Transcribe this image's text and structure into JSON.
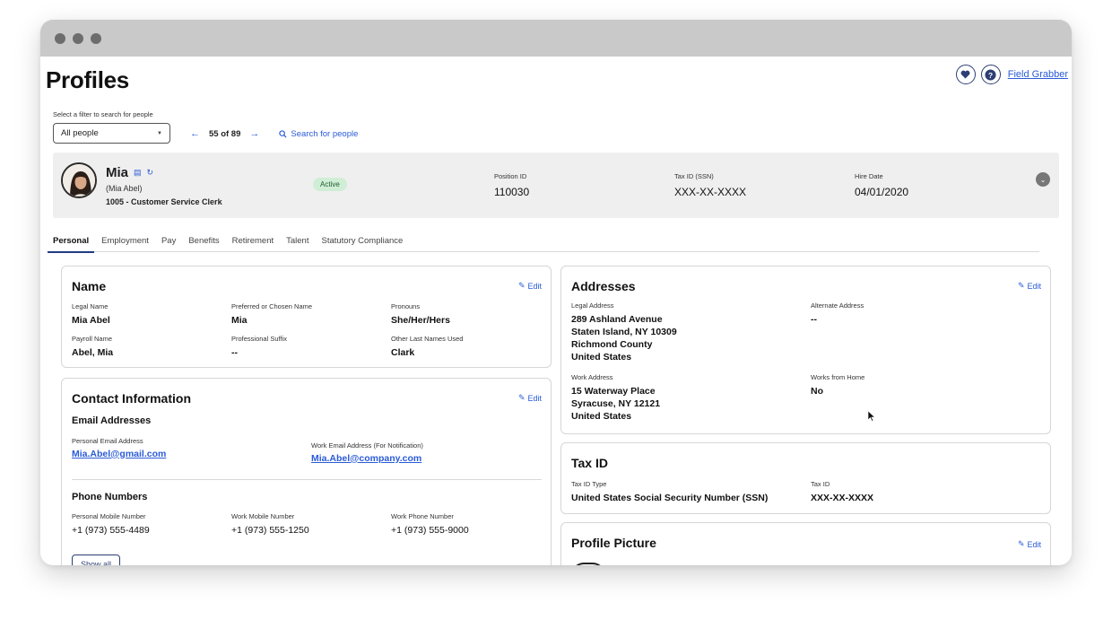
{
  "page": {
    "title": "Profiles"
  },
  "top_actions": {
    "field_grabber_label": "Field Grabber"
  },
  "filter": {
    "label": "Select a filter to search for people",
    "selected": "All people",
    "count_label": "55 of 89",
    "search_label": "Search for people"
  },
  "profile": {
    "name": "Mia",
    "alt_name": "(Mia Abel)",
    "role": "1005 - Customer Service Clerk",
    "status": "Active",
    "position_id_label": "Position ID",
    "position_id": "110030",
    "tax_id_label": "Tax ID (SSN)",
    "tax_id": "XXX-XX-XXXX",
    "hire_date_label": "Hire Date",
    "hire_date": "04/01/2020"
  },
  "tabs": [
    "Personal",
    "Employment",
    "Pay",
    "Benefits",
    "Retirement",
    "Talent",
    "Statutory Compliance"
  ],
  "edit_label": "Edit",
  "name_card": {
    "title": "Name",
    "fields": [
      {
        "label": "Legal Name",
        "value": "Mia Abel"
      },
      {
        "label": "Preferred or Chosen Name",
        "value": "Mia"
      },
      {
        "label": "Pronouns",
        "value": "She/Her/Hers"
      },
      {
        "label": "Payroll Name",
        "value": "Abel, Mia"
      },
      {
        "label": "Professional Suffix",
        "value": "--"
      },
      {
        "label": "Other Last Names Used",
        "value": "Clark"
      }
    ]
  },
  "contact_card": {
    "title": "Contact Information",
    "email_section": "Email Addresses",
    "personal_email_label": "Personal Email Address",
    "personal_email": "Mia.Abel@gmail.com",
    "work_email_label": "Work Email Address (For Notification)",
    "work_email": "Mia.Abel@company.com",
    "phone_section": "Phone Numbers",
    "phones": [
      {
        "label": "Personal Mobile Number",
        "value": "+1 (973) 555-4489"
      },
      {
        "label": "Work Mobile Number",
        "value": "+1 (973) 555-1250"
      },
      {
        "label": "Work Phone Number",
        "value": "+1 (973) 555-9000"
      }
    ],
    "show_all_label": "Show all"
  },
  "addresses_card": {
    "title": "Addresses",
    "legal_label": "Legal Address",
    "legal_lines": [
      "289 Ashland Avenue",
      "Staten Island, NY 10309",
      "Richmond County",
      "United States"
    ],
    "alternate_label": "Alternate Address",
    "alternate_value": "--",
    "work_label": "Work Address",
    "work_lines": [
      "15 Waterway Place",
      "Syracuse, NY 12121",
      "United States"
    ],
    "wfh_label": "Works from Home",
    "wfh_value": "No"
  },
  "taxid_card": {
    "title": "Tax ID",
    "type_label": "Tax ID Type",
    "type_value": "United States Social Security Number (SSN)",
    "id_label": "Tax ID",
    "id_value": "XXX-XX-XXXX"
  },
  "picture_card": {
    "title": "Profile Picture"
  },
  "colors": {
    "accent": "#2a5bd7",
    "navy": "#1f3b82",
    "badge_bg": "#cfeed5",
    "banner_bg": "#efefef"
  }
}
